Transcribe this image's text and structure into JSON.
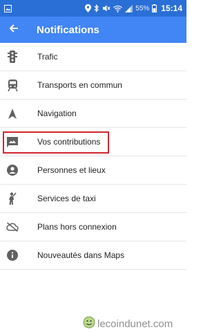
{
  "status_bar": {
    "battery_percent": "55%",
    "time": "15:14"
  },
  "app_bar": {
    "title": "Notifications"
  },
  "menu": {
    "items": [
      {
        "label": "Trafic",
        "icon": "traffic-light-icon"
      },
      {
        "label": "Transports en commun",
        "icon": "train-icon"
      },
      {
        "label": "Navigation",
        "icon": "navigation-arrow-icon"
      },
      {
        "label": "Vos contributions",
        "icon": "contributions-icon"
      },
      {
        "label": "Personnes et lieux",
        "icon": "person-circle-icon"
      },
      {
        "label": "Services de taxi",
        "icon": "taxi-hail-icon"
      },
      {
        "label": "Plans hors connexion",
        "icon": "cloud-off-icon"
      },
      {
        "label": "Nouveautés dans Maps",
        "icon": "info-icon"
      }
    ],
    "highlighted_item": "Vos contributions"
  },
  "watermark": {
    "text": "lecoindunet.com"
  },
  "colors": {
    "status_bar": "#2a6fd6",
    "app_bar": "#4285f4",
    "highlight": "#d0262e",
    "icon": "#616161"
  }
}
